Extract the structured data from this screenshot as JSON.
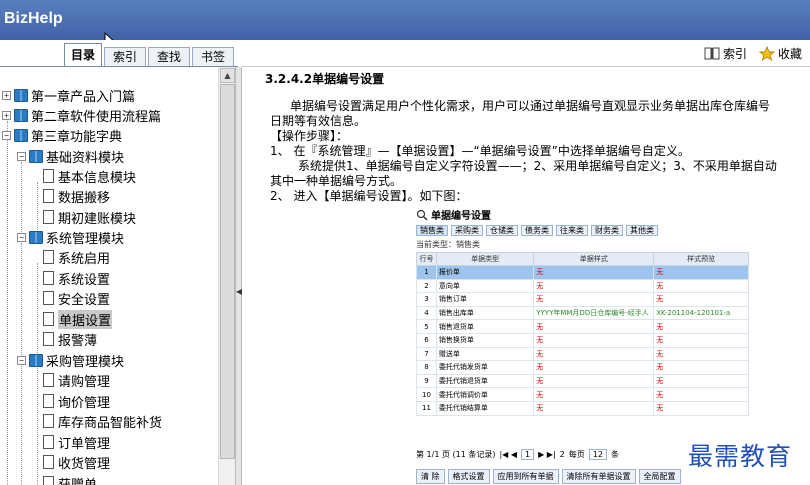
{
  "app": {
    "title": "BizHelp"
  },
  "tabs": [
    {
      "label": "目录",
      "active": true
    },
    {
      "label": "索引",
      "active": false
    },
    {
      "label": "查找",
      "active": false
    },
    {
      "label": "书签",
      "active": false
    }
  ],
  "toolbar": {
    "index_label": "索引",
    "favorite_label": "收藏"
  },
  "tree": [
    {
      "label": "第一章产品入门篇",
      "type": "book",
      "toggle": "+"
    },
    {
      "label": "第二章软件使用流程篇",
      "type": "book",
      "toggle": "+"
    },
    {
      "label": "第三章功能字典",
      "type": "book",
      "toggle": "−"
    },
    {
      "label": "基础资料模块",
      "type": "book",
      "toggle": "−"
    },
    {
      "label": "基本信息模块",
      "type": "page"
    },
    {
      "label": "数据搬移",
      "type": "page"
    },
    {
      "label": "期初建账模块",
      "type": "page"
    },
    {
      "label": "系统管理模块",
      "type": "book",
      "toggle": "−"
    },
    {
      "label": "系统启用",
      "type": "page"
    },
    {
      "label": "系统设置",
      "type": "page"
    },
    {
      "label": "安全设置",
      "type": "page"
    },
    {
      "label": "单据设置",
      "type": "page",
      "selected": true
    },
    {
      "label": "报警薄",
      "type": "page"
    },
    {
      "label": "采购管理模块",
      "type": "book",
      "toggle": "−"
    },
    {
      "label": "请购管理",
      "type": "page"
    },
    {
      "label": "询价管理",
      "type": "page"
    },
    {
      "label": "库存商品智能补货",
      "type": "page"
    },
    {
      "label": "订单管理",
      "type": "page"
    },
    {
      "label": "收货管理",
      "type": "page"
    },
    {
      "label": "获赠单",
      "type": "page"
    }
  ],
  "content": {
    "heading": "3.2.4.2单据编号设置",
    "lines": [
      "单据编号设置满足用户个性化需求，用户可以通过单据编号直观显示业务单据出库仓库编号",
      "日期等有效信息。",
      "【操作步骤】：",
      "1、    在『系统管理』—【单据设置】—“单据编号设置”中选择单据编号自定义。",
      "系统提供1、单据编号自定义字符设置——；2、采用单据编号自定义；3、不采用单据自动",
      "其中一种单据编号方式。",
      "2、    进入【单据编号设置】。如下图："
    ]
  },
  "dialog": {
    "title": "单据编号设置",
    "tabs": [
      "销售类",
      "采购类",
      "仓储类",
      "债务类",
      "往来类",
      "财务类",
      "其他类"
    ],
    "current_type": "当前类型：销售类",
    "columns": [
      "行号",
      "单据类型",
      "单据样式",
      "样式预览"
    ],
    "rows": [
      [
        "1",
        "报价单",
        "无",
        "无"
      ],
      [
        "2",
        "意向单",
        "无",
        "无"
      ],
      [
        "3",
        "销售订单",
        "无",
        "无"
      ],
      [
        "4",
        "销售出库单",
        "YYYY年MM月DD日仓库编号-经手人",
        "XK-201104-120101-a"
      ],
      [
        "5",
        "销售退货单",
        "无",
        "无"
      ],
      [
        "6",
        "销售换货单",
        "无",
        "无"
      ],
      [
        "7",
        "赠送单",
        "无",
        "无"
      ],
      [
        "8",
        "委托代销发货单",
        "无",
        "无"
      ],
      [
        "9",
        "委托代销退货单",
        "无",
        "无"
      ],
      [
        "10",
        "委托代销调价单",
        "无",
        "无"
      ],
      [
        "11",
        "委托代销结算单",
        "无",
        "无"
      ]
    ],
    "selected_row": 0,
    "pager": {
      "info": "第 1/1 页 (11 条记录)",
      "page": "1",
      "total": "2",
      "per_page_label": "每页",
      "per_page": "12",
      "unit": "条"
    },
    "buttons": [
      "清 除",
      "格式设置",
      "应用到所有单据",
      "清除所有单据设置",
      "全局配置"
    ]
  },
  "watermark": "最需教育"
}
